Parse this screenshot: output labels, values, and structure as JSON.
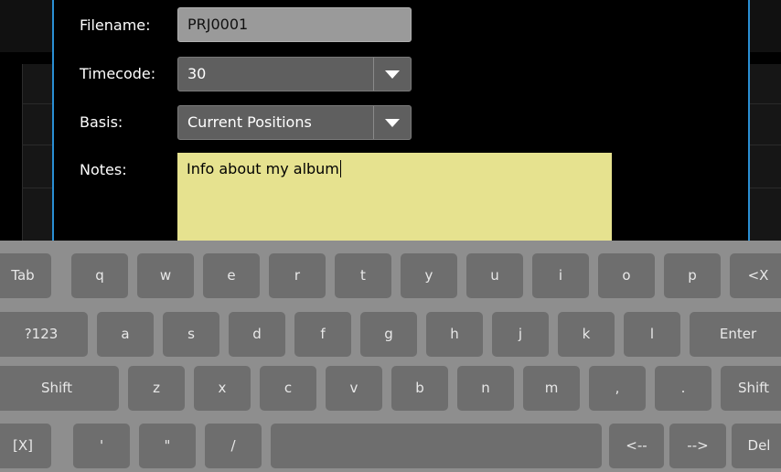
{
  "form": {
    "filename_label": "Filename:",
    "filename_value": "PRJ0001",
    "timecode_label": "Timecode:",
    "timecode_value": "30",
    "basis_label": "Basis:",
    "basis_value": "Current Positions",
    "notes_label": "Notes:",
    "notes_value": "Info about my album"
  },
  "keyboard": {
    "row1": [
      "Tab",
      "q",
      "w",
      "e",
      "r",
      "t",
      "y",
      "u",
      "i",
      "o",
      "p",
      "<X"
    ],
    "row2": [
      "?123",
      "a",
      "s",
      "d",
      "f",
      "g",
      "h",
      "j",
      "k",
      "l",
      "Enter"
    ],
    "row3": [
      "Shift",
      "z",
      "x",
      "c",
      "v",
      "b",
      "n",
      "m",
      ",",
      ".",
      "Shift"
    ],
    "row4": [
      "[X]",
      "'",
      "\"",
      "/",
      "",
      "<--",
      "-->",
      "Del"
    ]
  },
  "colors": {
    "accent_line": "#2a8fd4",
    "notes_background": "#e6e28f",
    "keyboard_background": "#8e8e8e",
    "key_background": "#6e6e6e"
  },
  "icons": {
    "dropdown": "chevron-down-icon"
  }
}
